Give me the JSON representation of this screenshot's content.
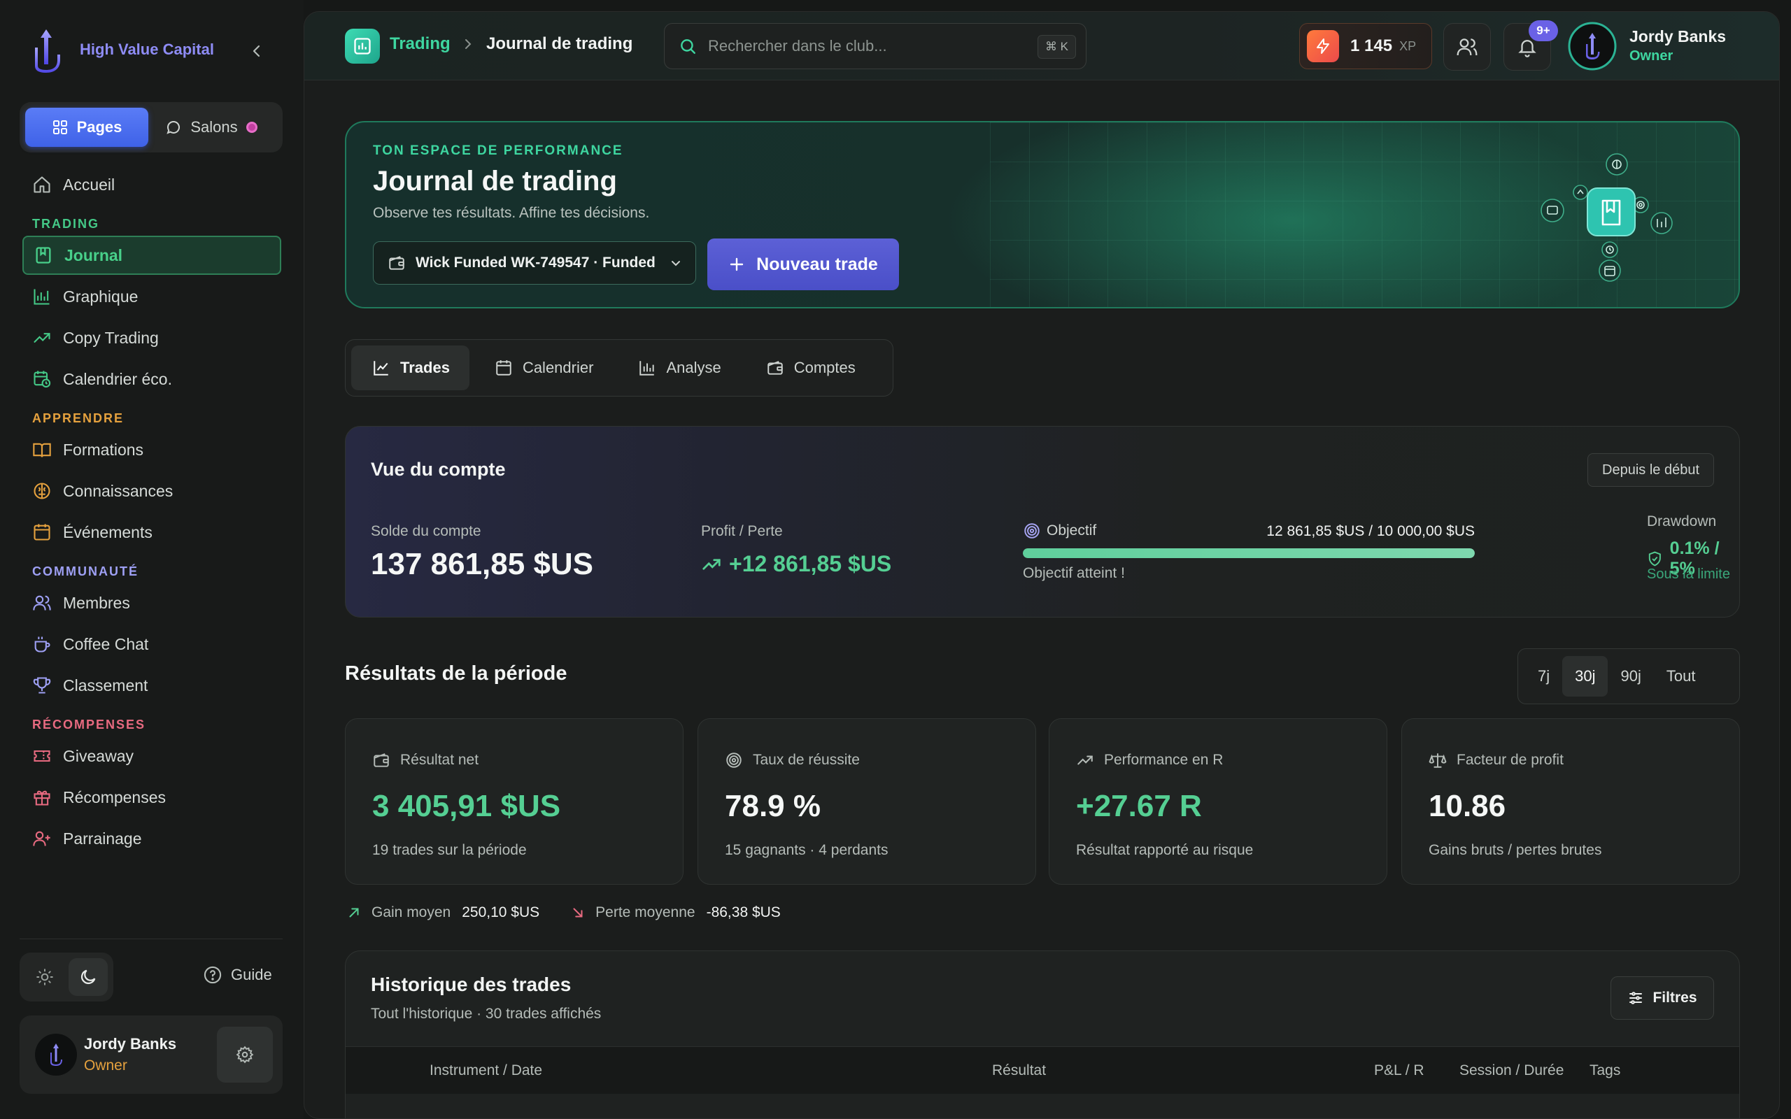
{
  "brand": {
    "name": "High Value Capital"
  },
  "segment": {
    "pages": "Pages",
    "rooms": "Salons"
  },
  "nav": {
    "home": "Accueil",
    "sec_trading": "TRADING",
    "journal": "Journal",
    "chart": "Graphique",
    "copy": "Copy Trading",
    "calendar": "Calendrier éco.",
    "sec_learn": "APPRENDRE",
    "courses": "Formations",
    "knowledge": "Connaissances",
    "events": "Événements",
    "sec_community": "COMMUNAUTÉ",
    "members": "Membres",
    "coffee": "Coffee Chat",
    "ranking": "Classement",
    "sec_rewards": "RÉCOMPENSES",
    "giveaway": "Giveaway",
    "rewards": "Récompenses",
    "referral": "Parrainage"
  },
  "sidebar_footer": {
    "guide": "Guide"
  },
  "user": {
    "name": "Jordy Banks",
    "role": "Owner"
  },
  "topbar": {
    "breadcrumb_parent": "Trading",
    "breadcrumb_current": "Journal de trading",
    "search_placeholder": "Rechercher dans le club...",
    "search_shortcut": "⌘ K",
    "xp_value": "1 145",
    "xp_unit": "XP",
    "notif_count": "9+"
  },
  "hero": {
    "kicker": "TON ESPACE DE PERFORMANCE",
    "title": "Journal de trading",
    "subtitle": "Observe tes résultats. Affine tes décisions.",
    "account": "Wick Funded WK-749547 · Funded",
    "new_trade": "Nouveau trade"
  },
  "tabs": {
    "trades": "Trades",
    "calendar": "Calendrier",
    "analysis": "Analyse",
    "accounts": "Comptes"
  },
  "account_view": {
    "title": "Vue du compte",
    "range": "Depuis le début",
    "balance_label": "Solde du compte",
    "balance": "137 861,85 $US",
    "pnl_label": "Profit / Perte",
    "pnl": "+12 861,85 $US",
    "goal_label": "Objectif",
    "goal_values": "12 861,85 $US / 10 000,00 $US",
    "goal_progress": 1.0,
    "goal_status": "Objectif atteint !",
    "drawdown_label": "Drawdown",
    "drawdown": "0.1% / 5%",
    "drawdown_status": "Sous la limite"
  },
  "period": {
    "title": "Résultats de la période",
    "options": [
      "7j",
      "30j",
      "90j",
      "Tout"
    ],
    "selected": "30j"
  },
  "kpis": [
    {
      "label": "Résultat net",
      "value": "3 405,91 $US",
      "sub": "19 trades sur la période",
      "color": "#55cf93"
    },
    {
      "label": "Taux de réussite",
      "value": "78.9 %",
      "sub": "15 gagnants · 4 perdants",
      "color": "#f5f7f6"
    },
    {
      "label": "Performance en R",
      "value": "+27.67 R",
      "sub": "Résultat rapporté au risque",
      "color": "#55cf93"
    },
    {
      "label": "Facteur de profit",
      "value": "10.86",
      "sub": "Gains bruts / pertes brutes",
      "color": "#f5f7f6"
    }
  ],
  "averages": {
    "gain_label": "Gain moyen",
    "gain": "250,10 $US",
    "loss_label": "Perte moyenne",
    "loss": "-86,38 $US"
  },
  "history": {
    "title": "Historique des trades",
    "subtitle": "Tout l'historique · 30 trades affichés",
    "filters": "Filtres",
    "columns": [
      "Instrument / Date",
      "Résultat",
      "P&L / R",
      "Session / Durée",
      "Tags"
    ]
  },
  "colors": {
    "accent_green": "#3ed6a0",
    "accent_indigo": "#5c60d6",
    "brand_purple": "#8e8cf5"
  }
}
